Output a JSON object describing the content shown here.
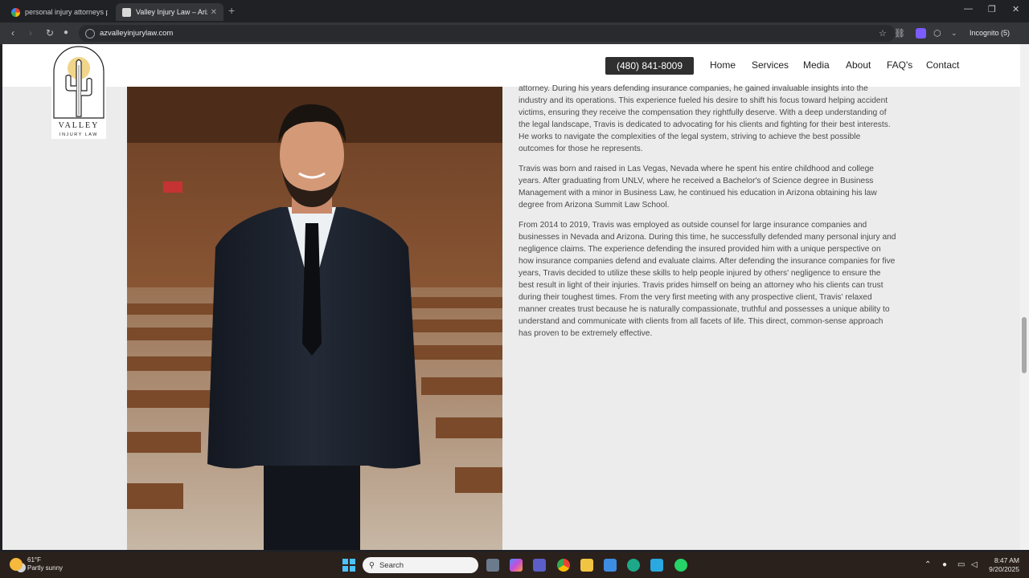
{
  "browser": {
    "tabs": [
      {
        "title": "personal injury attorneys pho"
      },
      {
        "title": "Valley Injury Law – Arizona's T"
      }
    ],
    "url": "azvalleyinjurylaw.com",
    "incognito_label": "Incognito (5)"
  },
  "site": {
    "logo": {
      "line1": "VALLEY",
      "line2": "INJURY LAW"
    },
    "phone": "(480) 841-8009",
    "nav": [
      "Home",
      "Services",
      "Media",
      "About",
      "FAQ's",
      "Contact"
    ]
  },
  "article": {
    "paragraphs": [
      "attorney. During his years defending insurance companies, he gained invaluable insights into the industry and its operations. This experience fueled his desire to shift his focus toward helping accident victims, ensuring they receive the compensation they rightfully deserve. With a deep understanding of the legal landscape, Travis is dedicated to advocating for his clients and fighting for their best interests. He works to navigate the complexities of the legal system, striving to achieve the best possible outcomes for those he represents.",
      "Travis was born and raised in Las Vegas, Nevada where he spent his entire childhood and college years. After graduating from UNLV, where he received a Bachelor's of Science degree in Business Management with a minor in Business Law, he continued his education in Arizona obtaining his law degree from Arizona Summit Law School.",
      "From 2014 to 2019, Travis was employed as outside counsel for large insurance companies and businesses in Nevada and Arizona. During this time, he successfully defended many personal injury and negligence claims. The experience defending the insured provided him with a unique perspective on how insurance companies defend and evaluate claims. After defending the insurance companies for five years, Travis decided to utilize these skills to help people injured by others' negligence to ensure the best result in light of their injuries. Travis prides himself on being an attorney who his clients can trust during their toughest times. From the very first meeting with any prospective client, Travis' relaxed manner creates trust because he is naturally compassionate, truthful and possesses a unique ability to understand and communicate with clients from all facets of life. This direct, common-sense approach has proven to be extremely effective."
    ]
  },
  "taskbar": {
    "weather_temp": "61°F",
    "weather_desc": "Partly sunny",
    "weather_badge": "1",
    "search_placeholder": "Search",
    "time": "8:47 AM",
    "date": "9/20/2025"
  },
  "colors": {
    "phone_button": "#2f2f2f",
    "page_bg": "#ececec",
    "text": "#4a4a4a"
  }
}
